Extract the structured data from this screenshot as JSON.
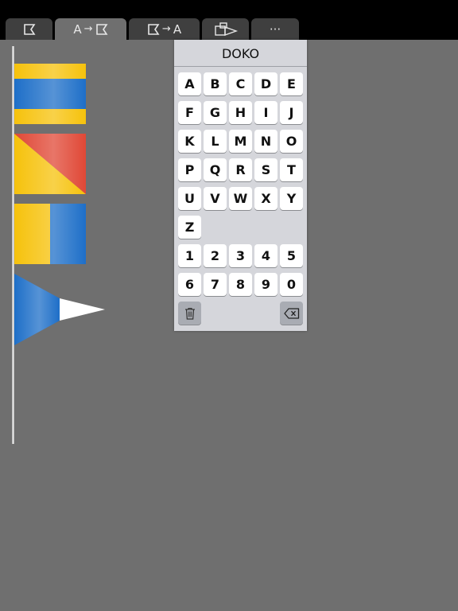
{
  "tabs": [
    {
      "id": "flag",
      "icon": "flag-outline-icon",
      "active": false
    },
    {
      "id": "letter-to-flag",
      "text": "A",
      "arrow": "→",
      "icon": "flag-outline-icon",
      "active": true
    },
    {
      "id": "flag-to-letter",
      "text": "A",
      "arrow": "→",
      "icon": "flag-outline-icon",
      "active": false
    },
    {
      "id": "flag-hoist",
      "icon": "flag-hoist-icon",
      "active": false
    },
    {
      "id": "more",
      "text": "···",
      "active": false
    }
  ],
  "flags": [
    {
      "letter": "D",
      "colors": [
        "#f6c20c",
        "#1e6fc8"
      ]
    },
    {
      "letter": "O",
      "colors": [
        "#f6c20c",
        "#e04836"
      ]
    },
    {
      "letter": "K",
      "colors": [
        "#f6c20c",
        "#1e6fc8"
      ]
    },
    {
      "pennant": "substitute",
      "colors": [
        "#1e6fc8",
        "#ffffff"
      ]
    }
  ],
  "keyboard": {
    "word": "DOKO",
    "letter_rows": [
      [
        "A",
        "B",
        "C",
        "D",
        "E"
      ],
      [
        "F",
        "G",
        "H",
        "I",
        "J"
      ],
      [
        "K",
        "L",
        "M",
        "N",
        "O"
      ],
      [
        "P",
        "Q",
        "R",
        "S",
        "T"
      ],
      [
        "U",
        "V",
        "W",
        "X",
        "Y"
      ],
      [
        "Z"
      ]
    ],
    "digit_rows": [
      [
        "1",
        "2",
        "3",
        "4",
        "5"
      ],
      [
        "6",
        "7",
        "8",
        "9",
        "0"
      ]
    ],
    "clear_icon": "trash-icon",
    "backspace_icon": "backspace-icon"
  }
}
